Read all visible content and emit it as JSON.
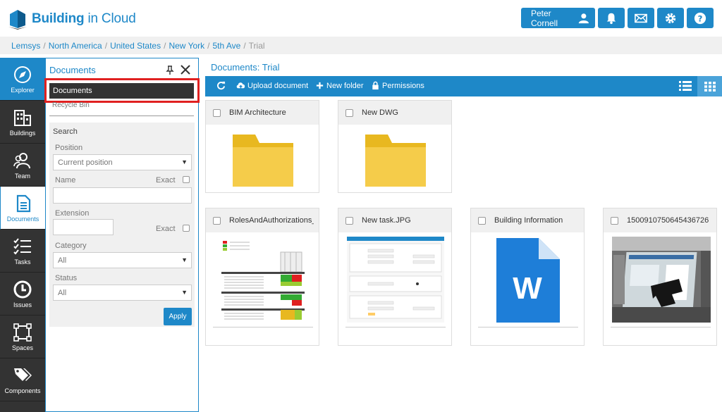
{
  "header": {
    "brand_bold": "Building",
    "brand_light": " in Cloud",
    "user_name": "Peter Cornell",
    "icons": [
      "user-icon",
      "bell-icon",
      "mail-icon",
      "gear-icon",
      "help-icon"
    ]
  },
  "breadcrumb": [
    "Lemsys",
    "North America",
    "United States",
    "New York",
    "5th Ave",
    "Trial"
  ],
  "nav": [
    {
      "label": "Explorer",
      "icon": "compass-icon"
    },
    {
      "label": "Buildings",
      "icon": "buildings-icon"
    },
    {
      "label": "Team",
      "icon": "team-icon"
    },
    {
      "label": "Documents",
      "icon": "document-icon"
    },
    {
      "label": "Tasks",
      "icon": "tasks-icon"
    },
    {
      "label": "Issues",
      "icon": "issues-icon"
    },
    {
      "label": "Spaces",
      "icon": "spaces-icon"
    },
    {
      "label": "Components",
      "icon": "components-icon"
    }
  ],
  "panel": {
    "title": "Documents",
    "selected": "Documents",
    "recycle": "Recycle Bin",
    "search": {
      "header": "Search",
      "position_label": "Position",
      "position_value": "Current position",
      "name_label": "Name",
      "exact_label": "Exact",
      "extension_label": "Extension",
      "category_label": "Category",
      "category_value": "All",
      "status_label": "Status",
      "status_value": "All",
      "apply_label": "Apply"
    }
  },
  "main": {
    "title": "Documents: Trial",
    "toolbar": {
      "upload": "Upload document",
      "new_folder": "New folder",
      "permissions": "Permissions"
    },
    "items": [
      {
        "name": "BIM Architecture",
        "type": "folder"
      },
      {
        "name": "New DWG",
        "type": "folder"
      },
      {
        "name": "RolesAndAuthorizations_I",
        "type": "spreadsheet-thumb"
      },
      {
        "name": "New task.JPG",
        "type": "form-thumb"
      },
      {
        "name": "Building Information",
        "type": "word-icon"
      },
      {
        "name": "1500910750645436726",
        "type": "photo-thumb"
      }
    ]
  },
  "colors": {
    "accent": "#1e88c8",
    "nav_bg": "#333333",
    "highlight": "#e02020",
    "folder": "#f5cc4a"
  }
}
